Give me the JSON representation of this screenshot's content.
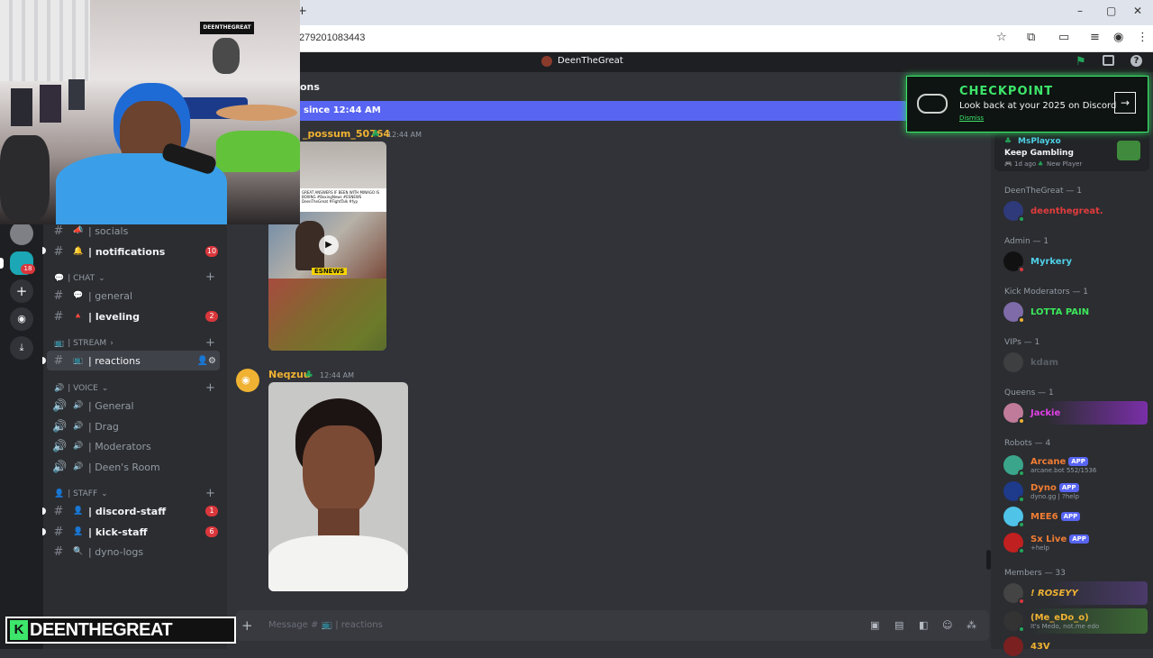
{
  "browser": {
    "url_fragment": "279201083443",
    "window_buttons": [
      "–",
      "▢",
      "✕"
    ],
    "new_tab": "+"
  },
  "discord": {
    "server_title": "DeenTheGreat",
    "header_fragment": "ons",
    "new_messages_banner": "since 12:44 AM",
    "server_badge": "18"
  },
  "channels": {
    "items": [
      {
        "name": "| socials",
        "emoji": "📣",
        "unread": false
      },
      {
        "name": "| notifications",
        "emoji": "🔔",
        "unread": true,
        "badge": "10"
      },
      {
        "category": "| CHAT",
        "emoji": "💬"
      },
      {
        "name": "| general",
        "emoji": "💬",
        "unread": false
      },
      {
        "name": "| leveling",
        "emoji": "🔺",
        "unread": true,
        "badge": "2"
      },
      {
        "category": "| STREAM",
        "emoji": "📺"
      },
      {
        "name": "| reactions",
        "emoji": "📺",
        "selected": true
      },
      {
        "category": "| VOICE",
        "emoji": "🔊"
      },
      {
        "name": "| General",
        "voice": true
      },
      {
        "name": "| Drag",
        "voice": true
      },
      {
        "name": "| Moderators",
        "voice": true
      },
      {
        "name": "| Deen's Room",
        "voice": true
      },
      {
        "category": "| STAFF",
        "emoji": "👤"
      },
      {
        "name": "| discord-staff",
        "emoji": "👤",
        "unread": true,
        "badge": "1"
      },
      {
        "name": "| kick-staff",
        "emoji": "👤",
        "unread": true,
        "badge": "6"
      },
      {
        "name": "| dyno-logs",
        "emoji": "🔍",
        "unread": false
      }
    ]
  },
  "messages": [
    {
      "author": "_possum_50764",
      "time": "12:44 AM",
      "author_color": "#f0b232",
      "image_caption": "GREAT ANSWERS IF BEEN WITH MINAGO IS BOXING #BoxingNews #ESNEWS DeenTheGreat #FightTalk #fyp",
      "image_tag": "ESNEWS"
    },
    {
      "author": "Neqzuu",
      "time": "12:44 AM",
      "author_color": "#f0b232"
    }
  ],
  "input": {
    "placeholder": "Message # 📺 | reactions"
  },
  "checkpoint": {
    "title": "CHECKPOINT",
    "subtitle": "Look back at your 2025 on Discord",
    "dismiss": "Dismiss"
  },
  "activity": {
    "name": "MsPlayxo",
    "status": "Keep Gambling",
    "meta": "1d ago",
    "tag": "New Player"
  },
  "members": {
    "groups": [
      {
        "header": "DeenTheGreat — 1",
        "members": [
          {
            "name": "deenthegreat.",
            "color": "#e03c3c"
          }
        ]
      },
      {
        "header": "Admin — 1",
        "members": [
          {
            "name": "Myrkery",
            "color": "#4fd1e8"
          }
        ]
      },
      {
        "header": "Kick Moderators — 1",
        "members": [
          {
            "name": "LOTTA PAIN",
            "color": "#3ce85a"
          }
        ]
      },
      {
        "header": "VIPs — 1",
        "members": [
          {
            "name": "kdam",
            "color": "#6d6f78"
          }
        ]
      },
      {
        "header": "Queens — 1",
        "members": [
          {
            "name": "Jackie",
            "color": "#e040e6"
          }
        ]
      },
      {
        "header": "Robots — 4",
        "members": [
          {
            "name": "Arcane",
            "color": "#f27d33",
            "app": "APP",
            "sub": "arcane.bot 552/1536"
          },
          {
            "name": "Dyno",
            "color": "#f27d33",
            "app": "APP",
            "sub": "dyno.gg | ?help"
          },
          {
            "name": "MEE6",
            "color": "#f27d33",
            "app": "APP"
          },
          {
            "name": "Sx Live",
            "color": "#f27d33",
            "app": "APP",
            "sub": "+help"
          }
        ]
      },
      {
        "header": "Members — 33",
        "members": [
          {
            "name": "! ROSEYY",
            "color": "#f0b232"
          },
          {
            "name": "(Me_eDo_o)",
            "color": "#f0b232",
            "sub": "It's Medo, not.me edo"
          },
          {
            "name": "43V",
            "color": "#f0b232"
          }
        ]
      }
    ]
  },
  "overlay": {
    "stream_logo": "DEENTHEGREAT",
    "stream_logo_k": "K"
  }
}
